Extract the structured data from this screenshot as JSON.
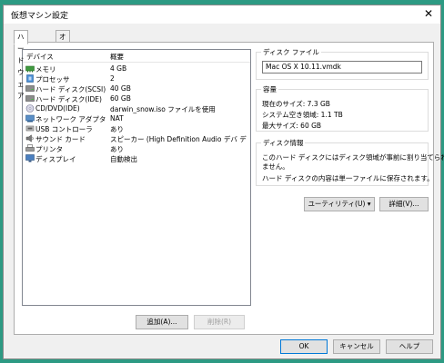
{
  "window": {
    "title": "仮想マシン設定",
    "close_glyph": "✕"
  },
  "tabs": [
    {
      "label": "ハードウェア"
    },
    {
      "label": "オプション"
    }
  ],
  "device_list": {
    "headers": {
      "device": "デバイス",
      "summary": "概要"
    },
    "rows": [
      {
        "device": "メモリ",
        "summary": "4 GB",
        "icon": "memory-icon"
      },
      {
        "device": "プロセッサ",
        "summary": "2",
        "icon": "processor-icon"
      },
      {
        "device": "ハード ディスク(SCSI)",
        "summary": "40 GB",
        "icon": "hard-disk-icon"
      },
      {
        "device": "ハード ディスク(IDE)",
        "summary": "60 GB",
        "icon": "hard-disk-icon"
      },
      {
        "device": "CD/DVD(IDE)",
        "summary": "darwin_snow.iso ファイルを使用",
        "icon": "cd-dvd-icon"
      },
      {
        "device": "ネットワーク アダプタ",
        "summary": "NAT",
        "icon": "network-adapter-icon"
      },
      {
        "device": "USB コントローラ",
        "summary": "あり",
        "icon": "usb-icon"
      },
      {
        "device": "サウンド カード",
        "summary": "スピーカー (High Definition Audio デバ デバ...",
        "icon": "sound-card-icon"
      },
      {
        "device": "プリンタ",
        "summary": "あり",
        "icon": "printer-icon"
      },
      {
        "device": "ディスプレイ",
        "summary": "自動検出",
        "icon": "display-icon"
      }
    ]
  },
  "list_buttons": {
    "add": "追加(A)...",
    "remove": "削除(R)"
  },
  "disk_file": {
    "label": "ディスク ファイル",
    "value": "Mac OS X 10.11.vmdk"
  },
  "capacity": {
    "label": "容量",
    "current_size": "現在のサイズ: 7.3 GB",
    "system_free": "システム空き領域: 1.1 TB",
    "max_size": "最大サイズ: 60 GB"
  },
  "disk_info": {
    "label": "ディスク情報",
    "line1": "このハード ディスクにはディスク領域が事前に割り当てられてい",
    "line2": "ません。",
    "line3": "ハード ディスクの内容は単一ファイルに保存されます。"
  },
  "utility_button": {
    "label": "ユーティリティ(U)",
    "caret": "▾"
  },
  "details_button": {
    "label": "詳細(V)..."
  },
  "footer": {
    "ok": "OK",
    "cancel": "キャンセル",
    "help": "ヘルプ"
  },
  "colors": {
    "desktop": "#2d9a83",
    "focus_border": "#0078d7",
    "selection": "#cce8ff"
  }
}
